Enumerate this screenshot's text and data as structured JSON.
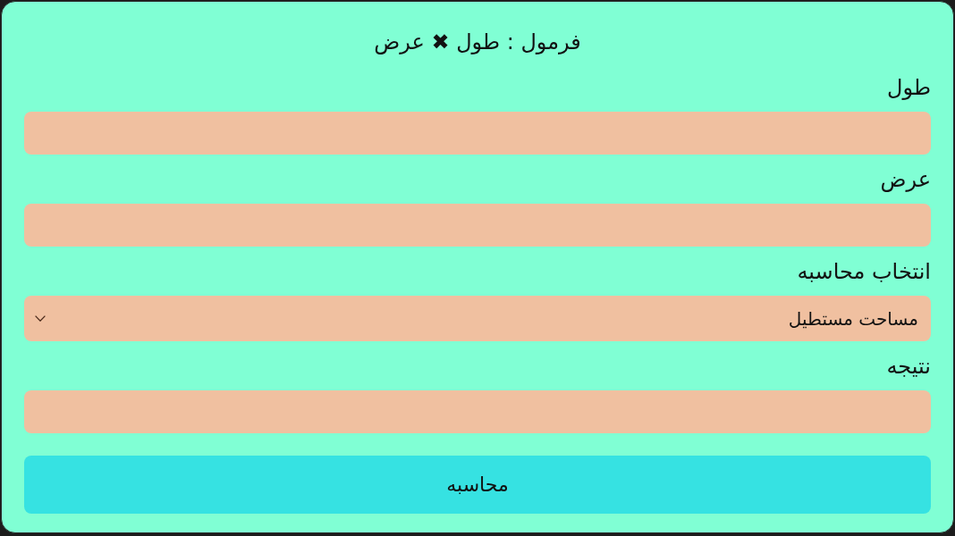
{
  "title": "فرمول : طول ✖ عرض",
  "fields": [
    {
      "kind": "input",
      "label": "طول"
    },
    {
      "kind": "input",
      "label": "عرض"
    },
    {
      "kind": "select",
      "label": "انتخاب محاسبه",
      "value": "مساحت مستطیل"
    },
    {
      "kind": "input",
      "label": "نتیجه"
    }
  ],
  "button": {
    "label": "محاسبه"
  }
}
